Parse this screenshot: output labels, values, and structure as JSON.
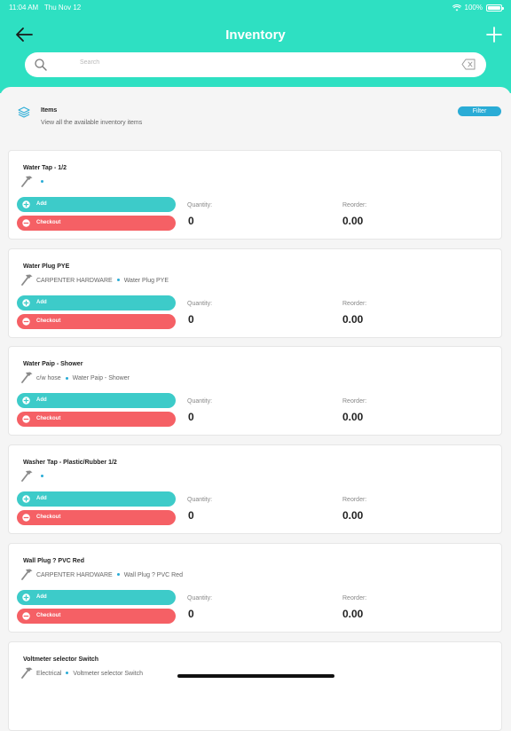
{
  "status_bar": {
    "time": "11:04 AM",
    "date": "Thu Nov 12",
    "battery": "100%",
    "icons": [
      "wifi-icon",
      "battery-icon"
    ]
  },
  "nav": {
    "title": "Inventory",
    "back_icon": "arrow-left-icon",
    "add_icon": "plus-icon"
  },
  "search": {
    "placeholder": "Search",
    "value": "",
    "clear_icon": "backspace-icon"
  },
  "section": {
    "title": "Items",
    "subtitle": "View all the available inventory items",
    "filter_label": "Filter",
    "icon": "layers-icon"
  },
  "labels": {
    "add": "Add",
    "checkout": "Checkout",
    "quantity": "Quantity:",
    "reorder": "Reorder:"
  },
  "items": [
    {
      "name": "Water Tap - 1/2",
      "category": "",
      "description": "",
      "quantity": "0",
      "reorder": "0.00"
    },
    {
      "name": "Water Plug PYE",
      "category": "CARPENTER HARDWARE",
      "description": "Water Plug PYE",
      "quantity": "0",
      "reorder": "0.00"
    },
    {
      "name": "Water Paip - Shower",
      "category": "c/w hose",
      "description": "Water Paip - Shower",
      "quantity": "0",
      "reorder": "0.00"
    },
    {
      "name": "Washer Tap - Plastic/Rubber 1/2",
      "category": "",
      "description": "",
      "quantity": "0",
      "reorder": "0.00"
    },
    {
      "name": "Wall Plug ? PVC Red",
      "category": "CARPENTER HARDWARE",
      "description": "Wall Plug ? PVC Red",
      "quantity": "0",
      "reorder": "0.00"
    },
    {
      "name": "Voltmeter selector Switch",
      "category": "Electrical",
      "description": "Voltmeter selector Switch",
      "quantity": "",
      "reorder": ""
    }
  ],
  "colors": {
    "header": "#2ee0c2",
    "add_button": "#3dcbc9",
    "checkout_button": "#f56065",
    "filter_button": "#2aacd6",
    "dot": "#2aacd6"
  }
}
